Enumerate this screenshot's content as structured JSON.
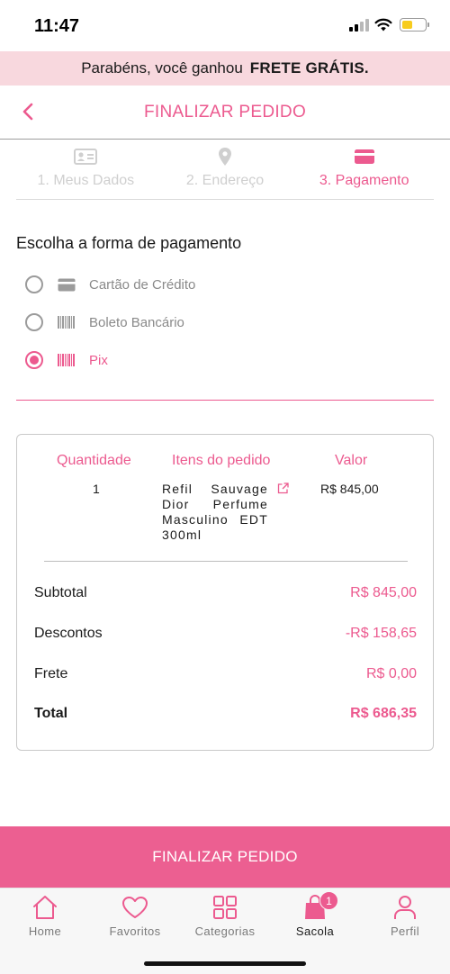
{
  "status_bar": {
    "time": "11:47"
  },
  "promo": {
    "text": "Parabéns, você ganhou",
    "highlight": "FRETE GRÁTIS."
  },
  "header": {
    "title": "FINALIZAR PEDIDO"
  },
  "steps": [
    {
      "label": "1. Meus Dados",
      "icon": "id-card-icon",
      "active": false
    },
    {
      "label": "2. Endereço",
      "icon": "location-pin-icon",
      "active": false
    },
    {
      "label": "3. Pagamento",
      "icon": "credit-card-icon",
      "active": true
    }
  ],
  "payment": {
    "title": "Escolha a forma de pagamento",
    "options": [
      {
        "label": "Cartão de Crédito",
        "icon": "credit-card-icon",
        "selected": false
      },
      {
        "label": "Boleto Bancário",
        "icon": "barcode-icon",
        "selected": false
      },
      {
        "label": "Pix",
        "icon": "barcode-icon",
        "selected": true
      }
    ]
  },
  "order": {
    "headers": {
      "quantity": "Quantidade",
      "items": "Itens do pedido",
      "value": "Valor"
    },
    "items": [
      {
        "quantity": "1",
        "name": "Refil Sauvage Dior Perfume Masculino EDT 300ml",
        "price": "R$ 845,00"
      }
    ],
    "summary": {
      "subtotal_label": "Subtotal",
      "subtotal_value": "R$ 845,00",
      "discount_label": "Descontos",
      "discount_value": "-R$ 158,65",
      "shipping_label": "Frete",
      "shipping_value": "R$ 0,00",
      "total_label": "Total",
      "total_value": "R$ 686,35"
    }
  },
  "cta": {
    "label": "FINALIZAR PEDIDO"
  },
  "tabbar": {
    "items": [
      {
        "label": "Home",
        "icon": "home-icon",
        "active": false
      },
      {
        "label": "Favoritos",
        "icon": "heart-icon",
        "active": false
      },
      {
        "label": "Categorias",
        "icon": "grid-icon",
        "active": false
      },
      {
        "label": "Sacola",
        "icon": "bag-icon",
        "active": true,
        "badge": "1"
      },
      {
        "label": "Perfil",
        "icon": "user-icon",
        "active": false
      }
    ]
  },
  "colors": {
    "accent": "#ec5a8f",
    "banner_bg": "#f8d8de",
    "button_bg": "#ec5f91"
  }
}
